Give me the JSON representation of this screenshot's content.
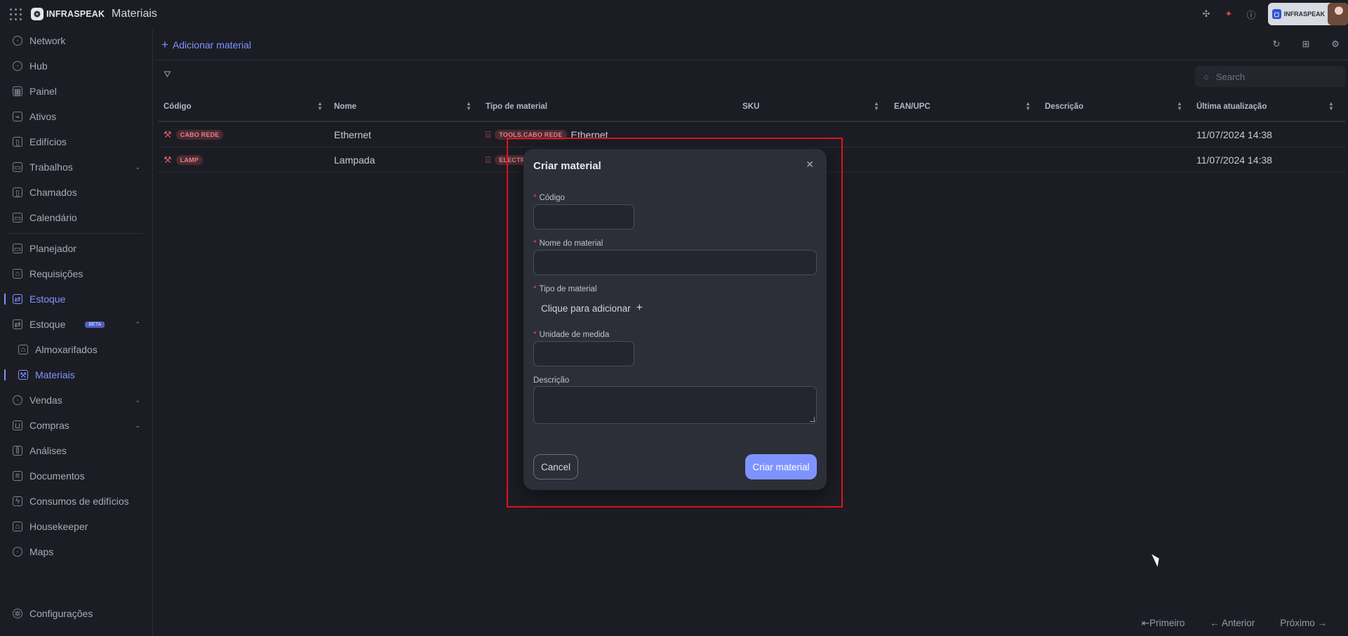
{
  "header": {
    "brand": "INFRASPEAK",
    "title": "Materiais",
    "account_brand": "INFRASPEAK"
  },
  "sidebar": {
    "items": [
      {
        "label": "Network",
        "icon": "globe-icon"
      },
      {
        "label": "Hub",
        "icon": "clock-icon"
      },
      {
        "label": "Painel",
        "icon": "dashboard-icon"
      },
      {
        "label": "Ativos",
        "icon": "assets-icon"
      },
      {
        "label": "Edifícios",
        "icon": "building-icon"
      },
      {
        "label": "Trabalhos",
        "icon": "calendar-icon"
      },
      {
        "label": "Chamados",
        "icon": "clipboard-icon"
      },
      {
        "label": "Calendário",
        "icon": "calendar-icon"
      },
      {
        "label": "Planejador",
        "icon": "planner-icon"
      },
      {
        "label": "Requisições",
        "icon": "requests-icon"
      },
      {
        "label": "Estoque",
        "icon": "stock-icon"
      },
      {
        "label": "Estoque",
        "icon": "stock-icon"
      },
      {
        "label": "Almoxarifados",
        "icon": "warehouse-icon"
      },
      {
        "label": "Materiais",
        "icon": "wrench-icon"
      },
      {
        "label": "Vendas",
        "icon": "tag-icon"
      },
      {
        "label": "Compras",
        "icon": "cart-icon"
      },
      {
        "label": "Análises",
        "icon": "chart-icon"
      },
      {
        "label": "Documentos",
        "icon": "document-icon"
      },
      {
        "label": "Consumos de edifícios",
        "icon": "bolt-icon"
      },
      {
        "label": "Housekeeper",
        "icon": "housekeeper-icon"
      },
      {
        "label": "Maps",
        "icon": "pin-icon"
      }
    ],
    "beta_badge": "BETA",
    "settings_label": "Configurações"
  },
  "toolbar": {
    "add_label": "Adicionar material",
    "search_placeholder": "Search"
  },
  "table": {
    "columns": [
      "Código",
      "Nome",
      "Tipo de material",
      "SKU",
      "EAN/UPC",
      "Descrição",
      "Última atualização"
    ],
    "rows": [
      {
        "code": "CABO REDE",
        "name": "Ethernet",
        "type_code": "TOOLS.CABO REDE",
        "type_name": "Ethernet",
        "sku": "",
        "ean": "",
        "description": "",
        "updated": "11/07/2024 14:38"
      },
      {
        "code": "LAMP",
        "name": "Lampada",
        "type_code": "ELECTR",
        "type_name": "",
        "sku": "",
        "ean": "",
        "description": "",
        "updated": "11/07/2024 14:38"
      }
    ]
  },
  "pagination": {
    "first": "Primeiro",
    "prev": "Anterior",
    "next": "Próximo"
  },
  "modal": {
    "title": "Criar material",
    "fields": {
      "code_label": "Código",
      "name_label": "Nome do material",
      "type_label": "Tipo de material",
      "type_action": "Clique para adicionar",
      "unit_label": "Unidade de medida",
      "description_label": "Descrição"
    },
    "cancel_label": "Cancel",
    "submit_label": "Criar material"
  },
  "colors": {
    "accent": "#7e93ff",
    "required": "#e24c55",
    "highlight": "#e3121b",
    "tag": "#e0818b"
  }
}
